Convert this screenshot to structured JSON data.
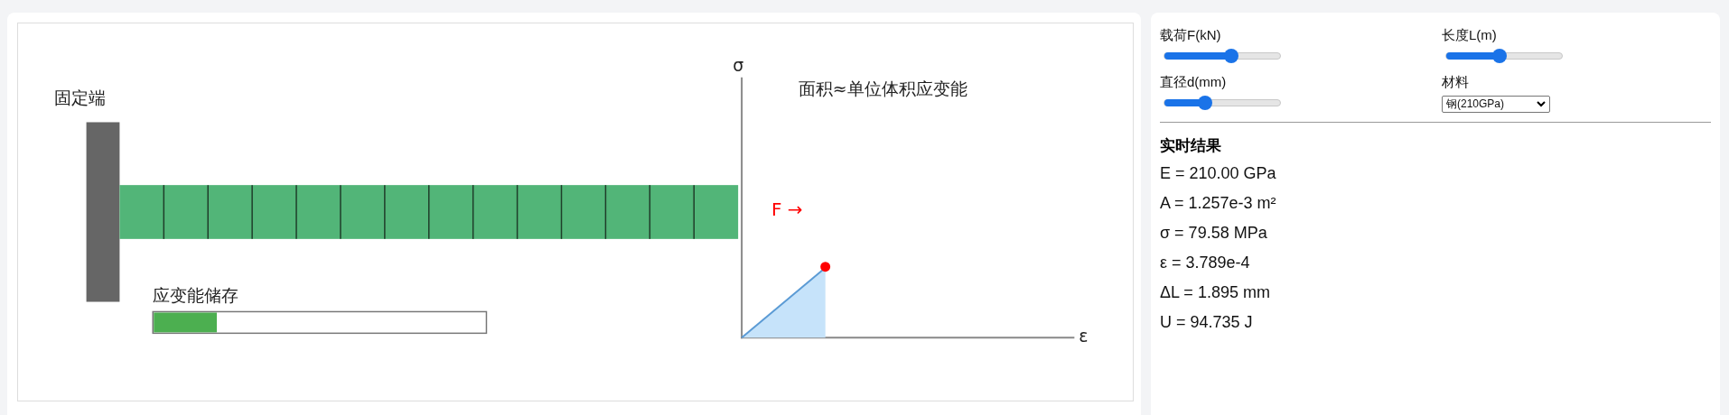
{
  "canvas": {
    "fixed_end_label": "固定端",
    "energy_label": "应变能储存",
    "energy": {
      "level": 0.19
    },
    "chart_title": "面积≈单位体积应变能",
    "y_axis_label": "σ",
    "x_axis_label": "ε",
    "force_label": "F →"
  },
  "controls": [
    {
      "kind": "slider",
      "label": "载荷F(kN)",
      "level": 0.58
    },
    {
      "kind": "slider",
      "label": "长度L(m)",
      "level": 0.46
    },
    {
      "kind": "slider",
      "label": "直径d(mm)",
      "level": 0.35
    },
    {
      "kind": "select",
      "label": "材料",
      "value": "钢(210GPa)"
    }
  ],
  "results": {
    "title": "实时结果",
    "lines": [
      "E = 210.00 GPa",
      "A = 1.257e-3 m²",
      "σ = 79.58 MPa",
      "ε = 3.789e-4",
      "ΔL = 1.895 mm",
      "U = 94.735 J"
    ]
  }
}
